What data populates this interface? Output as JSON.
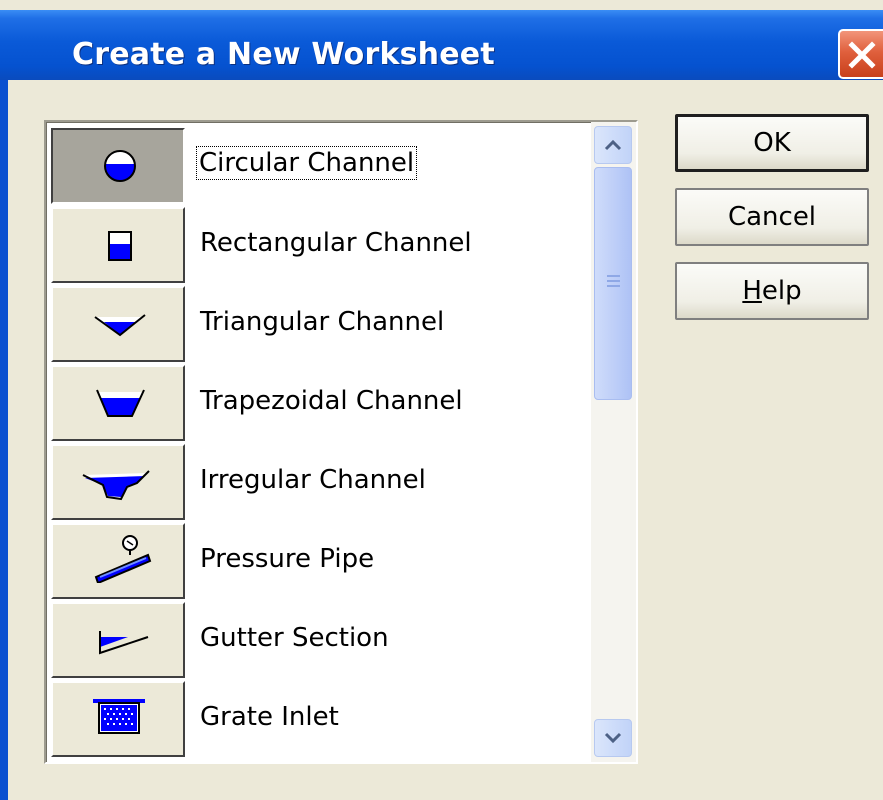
{
  "window": {
    "title": "Create a New Worksheet",
    "close_icon": "close-icon"
  },
  "list": {
    "items": [
      {
        "label": "Circular Channel",
        "icon": "circular-channel-icon",
        "selected": true
      },
      {
        "label": "Rectangular Channel",
        "icon": "rectangular-channel-icon",
        "selected": false
      },
      {
        "label": "Triangular Channel",
        "icon": "triangular-channel-icon",
        "selected": false
      },
      {
        "label": "Trapezoidal Channel",
        "icon": "trapezoidal-channel-icon",
        "selected": false
      },
      {
        "label": "Irregular Channel",
        "icon": "irregular-channel-icon",
        "selected": false
      },
      {
        "label": "Pressure Pipe",
        "icon": "pressure-pipe-icon",
        "selected": false
      },
      {
        "label": "Gutter Section",
        "icon": "gutter-section-icon",
        "selected": false
      },
      {
        "label": "Grate Inlet",
        "icon": "grate-inlet-icon",
        "selected": false
      }
    ]
  },
  "buttons": {
    "ok": "OK",
    "cancel": "Cancel",
    "help_mnemonic": "H",
    "help_rest": "elp"
  },
  "colors": {
    "water": "#0000ff",
    "title_bar": "#0552d0",
    "dialog_bg": "#ece9d8"
  }
}
